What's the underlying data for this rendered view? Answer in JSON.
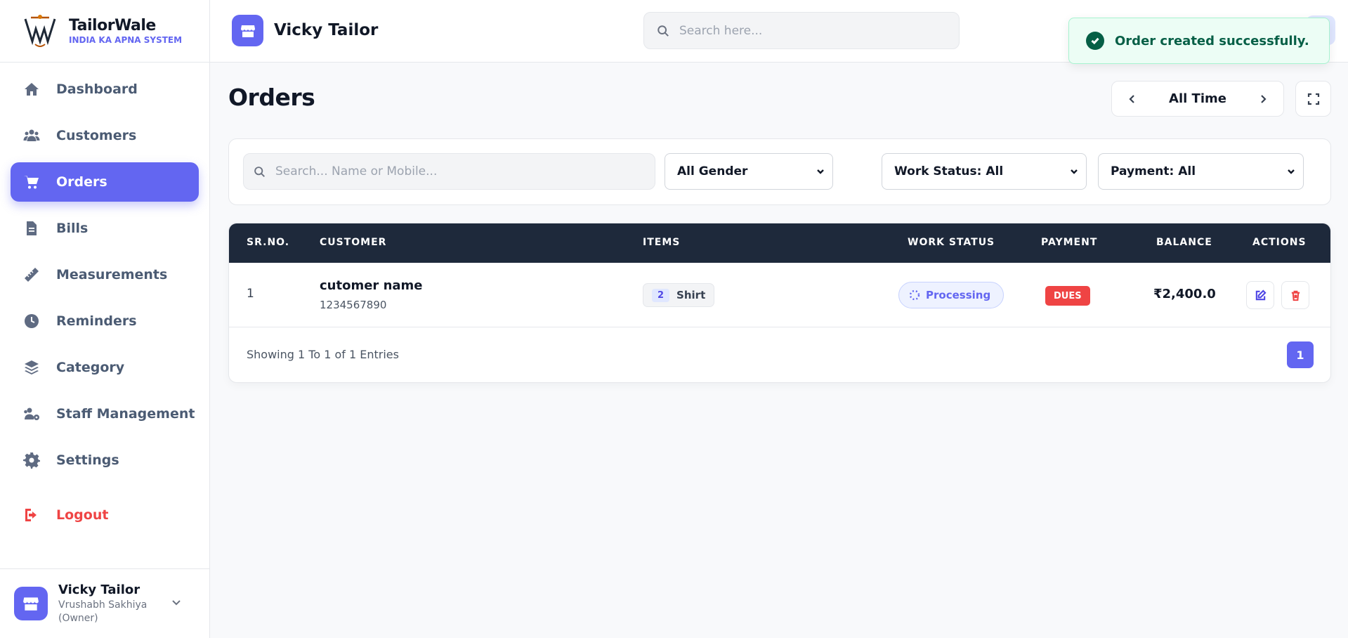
{
  "brand": {
    "name": "TailorWale",
    "tagline": "INDIA KA APNA SYSTEM"
  },
  "sidebar": {
    "items": [
      {
        "label": "Dashboard",
        "icon": "home-icon"
      },
      {
        "label": "Customers",
        "icon": "users-icon"
      },
      {
        "label": "Orders",
        "icon": "cart-icon",
        "active": true
      },
      {
        "label": "Bills",
        "icon": "bill-icon"
      },
      {
        "label": "Measurements",
        "icon": "ruler-icon"
      },
      {
        "label": "Reminders",
        "icon": "clock-icon"
      },
      {
        "label": "Category",
        "icon": "layers-icon"
      },
      {
        "label": "Staff Management",
        "icon": "staff-icon"
      },
      {
        "label": "Settings",
        "icon": "gear-icon"
      }
    ],
    "logout": "Logout",
    "user": {
      "name": "Vicky Tailor",
      "role": "Vrushabh Sakhiya (Owner)"
    }
  },
  "header": {
    "shop_name": "Vicky Tailor",
    "search_placeholder": "Search here..."
  },
  "toast": {
    "message": "Order created successfully."
  },
  "page": {
    "title": "Orders",
    "range_label": "All Time"
  },
  "filters": {
    "search_placeholder": "Search... Name or Mobile...",
    "gender": "All Gender",
    "work_status": "Work Status: All",
    "payment": "Payment: All"
  },
  "table": {
    "columns": [
      "SR.NO.",
      "CUSTOMER",
      "ITEMS",
      "WORK STATUS",
      "PAYMENT",
      "BALANCE",
      "ACTIONS"
    ],
    "rows": [
      {
        "sr": "1",
        "customer_name": "cutomer name",
        "customer_mobile": "1234567890",
        "item_qty": "2",
        "item_name": "Shirt",
        "work_status": "Processing",
        "payment": "DUES",
        "balance": "₹2,400.0"
      }
    ],
    "footer_info": "Showing 1 To 1 of 1 Entries",
    "current_page": "1"
  },
  "colors": {
    "accent": "#6366f1",
    "table_header": "#1e293b",
    "danger": "#ef4444",
    "success_text": "#065f46"
  }
}
